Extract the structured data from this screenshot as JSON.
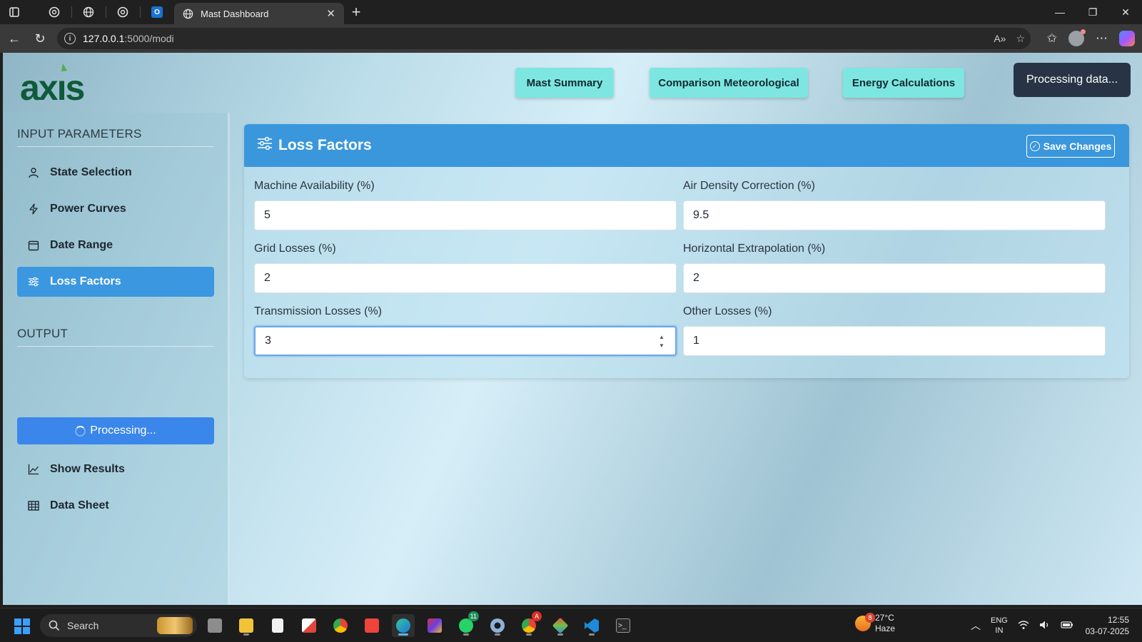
{
  "browser": {
    "active_tab_title": "Mast Dashboard",
    "url_host": "127.0.0.1",
    "url_path": ":5000/modi"
  },
  "header": {
    "nav_buttons": [
      {
        "label": "Mast Summary"
      },
      {
        "label": "Comparison Meteorological"
      },
      {
        "label": "Energy Calculations"
      }
    ],
    "status_label": "Processing data..."
  },
  "sidebar": {
    "input_heading": "INPUT PARAMETERS",
    "input_items": [
      {
        "label": "State Selection",
        "icon": "person-icon"
      },
      {
        "label": "Power Curves",
        "icon": "lightning-icon"
      },
      {
        "label": "Date Range",
        "icon": "calendar-icon"
      },
      {
        "label": "Loss Factors",
        "icon": "sliders-icon",
        "active": true
      }
    ],
    "output_heading": "OUTPUT",
    "processing_label": "Processing...",
    "output_items": [
      {
        "label": "Show Results",
        "icon": "line-chart-icon"
      },
      {
        "label": "Data Sheet",
        "icon": "table-icon"
      }
    ]
  },
  "panel": {
    "title": "Loss Factors",
    "save_label": "Save Changes",
    "fields": [
      {
        "label": "Machine Availability (%)",
        "value": "5"
      },
      {
        "label": "Air Density Correction (%)",
        "value": "9.5"
      },
      {
        "label": "Grid Losses (%)",
        "value": "2"
      },
      {
        "label": "Horizontal Extrapolation (%)",
        "value": "2"
      },
      {
        "label": "Transmission Losses (%)",
        "value": "3"
      },
      {
        "label": "Other Losses (%)",
        "value": "1"
      }
    ]
  },
  "taskbar": {
    "search_label": "Search",
    "weather_temp": "27°C",
    "weather_desc": "Haze",
    "weather_badge": "8",
    "whatsapp_badge": "11",
    "lang_top": "ENG",
    "lang_bottom": "IN",
    "time": "12:55",
    "date": "03-07-2025"
  },
  "colors": {
    "accent": "#3a97dc",
    "nav_button": "#7ee6e0",
    "status_dark": "#283445",
    "processing": "#3a86ea"
  }
}
